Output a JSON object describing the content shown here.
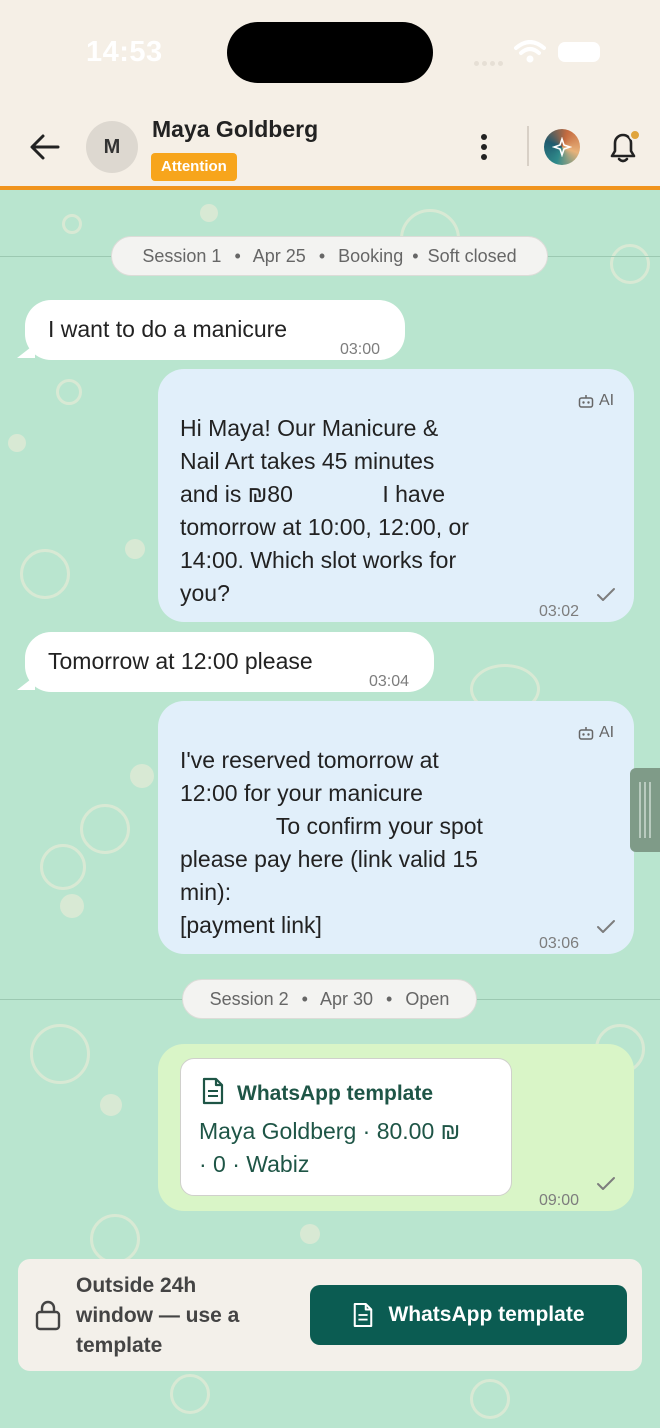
{
  "status_bar": {
    "time": "14:53"
  },
  "header": {
    "avatar_initial": "M",
    "contact_name": "Maya Goldberg",
    "badge": "Attention"
  },
  "sessions": [
    {
      "label": "Session 1",
      "date": "Apr 25",
      "topic": "Booking",
      "state": "Soft closed",
      "sep": "•"
    },
    {
      "label": "Session 2",
      "date": "Apr 30",
      "state": "Open",
      "sep": "•"
    }
  ],
  "messages": [
    {
      "direction": "in",
      "text": "I want to do a manicure",
      "time": "03:00"
    },
    {
      "direction": "out",
      "ai": "AI",
      "text": "Hi Maya! Our Manicure &\nNail Art takes 45 minutes\nand is ₪80              I have\ntomorrow at 10:00, 12:00, or\n14:00. Which slot works for\nyou?",
      "time": "03:02"
    },
    {
      "direction": "in",
      "text": "Tomorrow at 12:00 please",
      "time": "03:04"
    },
    {
      "direction": "out",
      "ai": "AI",
      "text": "I've reserved tomorrow at\n12:00 for your manicure\n               To confirm your spot\nplease pay here (link valid 15\nmin):\n[payment link]",
      "time": "03:06"
    },
    {
      "direction": "out",
      "type": "template",
      "template_title": "WhatsApp template",
      "template_body": "Maya Goldberg · 80.00 ₪\n· 0 · Wabiz",
      "time": "09:00"
    }
  ],
  "composer": {
    "note": "Outside 24h window — use a template",
    "button_label": "WhatsApp template"
  },
  "colors": {
    "accent_orange": "#f0941e",
    "badge_orange": "#f7a51c",
    "primary_green": "#0b5c52",
    "chat_bg": "#b9e5cf",
    "outgoing_bubble": "#e1effa",
    "template_bubble": "#d9f5c7"
  },
  "icons": {
    "back": "arrow-left-icon",
    "more": "more-vertical-icon",
    "assistant": "sparkle-avatar-icon",
    "bell": "bell-icon",
    "robot": "robot-icon",
    "check": "check-icon",
    "doc": "document-icon",
    "lock": "lock-icon"
  }
}
